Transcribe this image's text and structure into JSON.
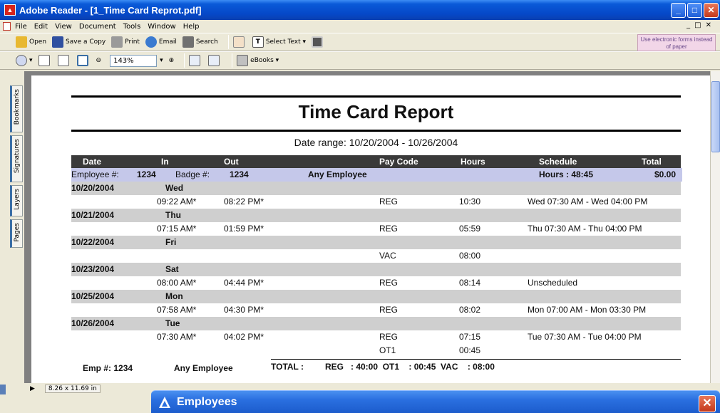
{
  "window": {
    "title": "Adobe Reader - [1_Time Card Reprot.pdf]"
  },
  "menu": [
    "File",
    "Edit",
    "View",
    "Document",
    "Tools",
    "Window",
    "Help"
  ],
  "toolbar1": {
    "open": "Open",
    "save_copy": "Save a Copy",
    "print": "Print",
    "email": "Email",
    "search": "Search",
    "select_text": "Select Text"
  },
  "toolbar2": {
    "zoom": "143%",
    "ebooks": "eBooks"
  },
  "electronic_forms": "Use electronic forms instead of paper",
  "side_tabs": [
    "Bookmarks",
    "Signatures",
    "Layers",
    "Pages"
  ],
  "status": {
    "page_size": "8.26 x 11.69 in"
  },
  "report": {
    "title": "Time Card Report",
    "date_range": "Date range: 10/20/2004 - 10/26/2004",
    "headers": {
      "date": "Date",
      "in": "In",
      "out": "Out",
      "pay_code": "Pay Code",
      "hours": "Hours",
      "schedule": "Schedule",
      "total": "Total"
    },
    "employee": {
      "emp_label": "Employee #:",
      "emp_num": "1234",
      "badge_label": "Badge #:",
      "badge_num": "1234",
      "name": "Any Employee",
      "hours": "Hours : 48:45",
      "total": "$0.00"
    },
    "days": [
      {
        "date": "10/20/2004",
        "day": "Wed",
        "entries": [
          {
            "in": "09:22 AM*",
            "out": "08:22 PM*",
            "code": "REG",
            "hours": "10:30",
            "schedule": "Wed 07:30 AM  -  Wed 04:00 PM"
          }
        ]
      },
      {
        "date": "10/21/2004",
        "day": "Thu",
        "entries": [
          {
            "in": "07:15 AM*",
            "out": "01:59 PM*",
            "code": "REG",
            "hours": "05:59",
            "schedule": "Thu 07:30 AM  -  Thu 04:00 PM"
          }
        ]
      },
      {
        "date": "10/22/2004",
        "day": "Fri",
        "entries": [
          {
            "in": "",
            "out": "",
            "code": "VAC",
            "hours": "08:00",
            "schedule": ""
          }
        ]
      },
      {
        "date": "10/23/2004",
        "day": "Sat",
        "entries": [
          {
            "in": "08:00 AM*",
            "out": "04:44 PM*",
            "code": "REG",
            "hours": "08:14",
            "schedule": "Unscheduled"
          }
        ]
      },
      {
        "date": "10/25/2004",
        "day": "Mon",
        "entries": [
          {
            "in": "07:58 AM*",
            "out": "04:30 PM*",
            "code": "REG",
            "hours": "08:02",
            "schedule": "Mon 07:00 AM  -  Mon 03:30 PM"
          }
        ]
      },
      {
        "date": "10/26/2004",
        "day": "Tue",
        "entries": [
          {
            "in": "07:30 AM*",
            "out": "04:02 PM*",
            "code": "REG",
            "hours": "07:15",
            "schedule": "Tue 07:30 AM  -  Tue 04:00 PM"
          },
          {
            "in": "",
            "out": "",
            "code": "OT1",
            "hours": "00:45",
            "schedule": ""
          }
        ]
      }
    ],
    "footer": {
      "emp": "Emp #: 1234",
      "name": "Any Employee",
      "total_label": "TOTAL :",
      "totals": "REG   : 40:00  OT1    : 00:45  VAC    : 08:00"
    }
  },
  "employees_bar": {
    "title": "Employees"
  }
}
